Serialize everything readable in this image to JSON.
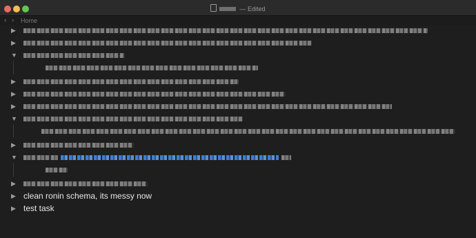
{
  "window": {
    "title_status": "— Edited"
  },
  "nav": {
    "back_glyph": "‹",
    "forward_glyph": "›",
    "breadcrumb": "Home"
  },
  "outline": {
    "collapsed_glyph": "▶",
    "expanded_glyph": "▼",
    "visible_items": [
      {
        "label": "clean ronin schema, its messy now"
      },
      {
        "label": "test task"
      }
    ]
  },
  "colors": {
    "background": "#1e1e1e",
    "titlebar": "#2b2b2b",
    "text": "#e6e6e6",
    "link": "#4b8ee8"
  }
}
